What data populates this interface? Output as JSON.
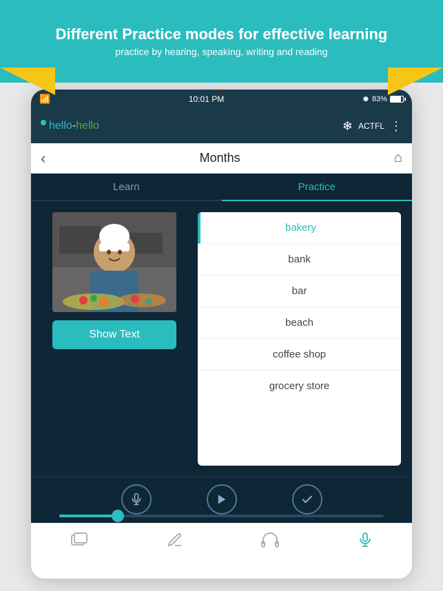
{
  "banner": {
    "title": "Different Practice modes for effective learning",
    "subtitle": "practice by hearing, speaking, writing and reading"
  },
  "status_bar": {
    "time": "10:01 PM",
    "battery_percent": "83%",
    "bluetooth_label": "BT"
  },
  "app_header": {
    "logo_hello1": "hello",
    "logo_dash": "-",
    "logo_hello2": "hello",
    "org_label": "ACTFL"
  },
  "nav": {
    "title": "Months",
    "back_icon": "‹",
    "home_icon": "⌂"
  },
  "tabs": {
    "learn_label": "Learn",
    "practice_label": "Practice"
  },
  "show_text_btn": "Show Text",
  "word_list": {
    "items": [
      {
        "label": "bakery",
        "selected": true
      },
      {
        "label": "bank",
        "selected": false
      },
      {
        "label": "bar",
        "selected": false
      },
      {
        "label": "beach",
        "selected": false
      },
      {
        "label": "coffee shop",
        "selected": false
      },
      {
        "label": "grocery store",
        "selected": false
      }
    ]
  },
  "controls": {
    "mic_icon": "🎤",
    "play_icon": "▶",
    "check_icon": "✓"
  },
  "progress": {
    "value": 18,
    "label": "18%"
  },
  "tab_bar": {
    "items": [
      {
        "icon": "🃏",
        "label": "",
        "active": false
      },
      {
        "icon": "✏️",
        "label": "",
        "active": false
      },
      {
        "icon": "🎧",
        "label": "",
        "active": false
      },
      {
        "icon": "🎤",
        "label": "",
        "active": true
      }
    ]
  }
}
